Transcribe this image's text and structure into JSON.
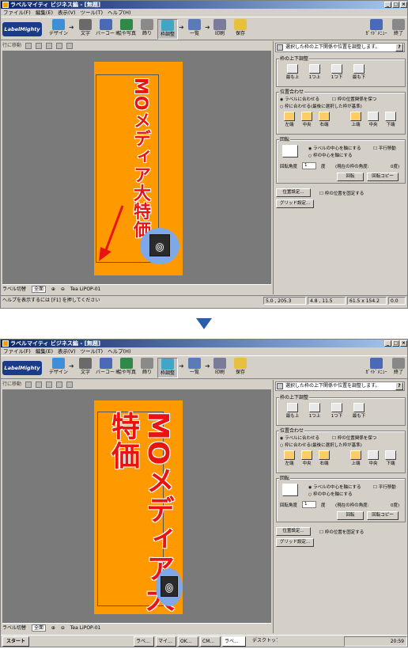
{
  "app": {
    "title": "ラベルマイティ ビジネス編 - [無題]",
    "menu": [
      "ファイル(F)",
      "編集(E)",
      "表示(V)",
      "ツール(T)",
      "ヘルプ(H)"
    ],
    "logo": "LabelMighty",
    "toolbar": [
      "デザイン",
      "文字",
      "バーコード",
      "絵や写真",
      "飾り",
      "枠調整",
      "一覧",
      "印刷",
      "保存"
    ],
    "toolbar_right": [
      "ｶﾞｲﾄﾞﾒﾆｭｰ",
      "終了"
    ],
    "subtool_text": "行に移動"
  },
  "label": {
    "text": "MOメディア大特価"
  },
  "panel": {
    "header": "選択した枠の上下関係や位置を調整します。",
    "help": "?",
    "order_group": "枠の上下調整",
    "order_buttons": [
      "最も上",
      "1つ上",
      "1つ下",
      "最も下"
    ],
    "align_group": "位置合わせ",
    "align_radio1": "ラベルに合わせる",
    "align_check1": "枠の位置関係を保つ",
    "align_radio2": "枠に合わせる(最後に選択した枠が基準)",
    "align_buttons": [
      "左端",
      "中央",
      "右端",
      "上端",
      "中央",
      "下端"
    ],
    "rotate_group": "回転",
    "rotate_radio1": "ラベルの中心を軸にする",
    "rotate_check": "平行移動",
    "rotate_radio2": "枠の中心を軸にする",
    "angle_label": "回転角度",
    "angle_value": "1",
    "angle_unit": "度",
    "current_angle_label": "(現在の枠の角度:",
    "current_angle_value": "0度)",
    "rotate_btn": "回転",
    "rotate_copy_btn": "回転コピー",
    "position_btn": "位置設定...",
    "lock_check": "枠の位置を固定する",
    "grid_btn": "グリッド設定..."
  },
  "canvas_tabs": {
    "label_switch": "ラベル切替",
    "view": "全面",
    "doc": "Tea LiPOP-01"
  },
  "top": {
    "status_help": "ヘルプを表示するには [F1] を押してください",
    "status_pos": "5.0 , 205.3",
    "status_size": "4.8 , 11.5",
    "status_label": "61.5 x 154.2",
    "status_zoom": "0.0"
  },
  "bottom": {
    "taskbar_start": "スタート",
    "taskbar_tasks": [
      "ラベ...",
      "マイ...",
      "OK...",
      "CM...",
      "ラベ..."
    ],
    "taskbar_desktop": "デスクトップ",
    "clock": "20:59"
  },
  "colors": {
    "label_bg": "#ff9900",
    "text_red": "#e81414",
    "canvas_bg": "#7a7a7a",
    "arrow_blue": "#2a5db0",
    "disk_blue": "#7fa8e8"
  }
}
